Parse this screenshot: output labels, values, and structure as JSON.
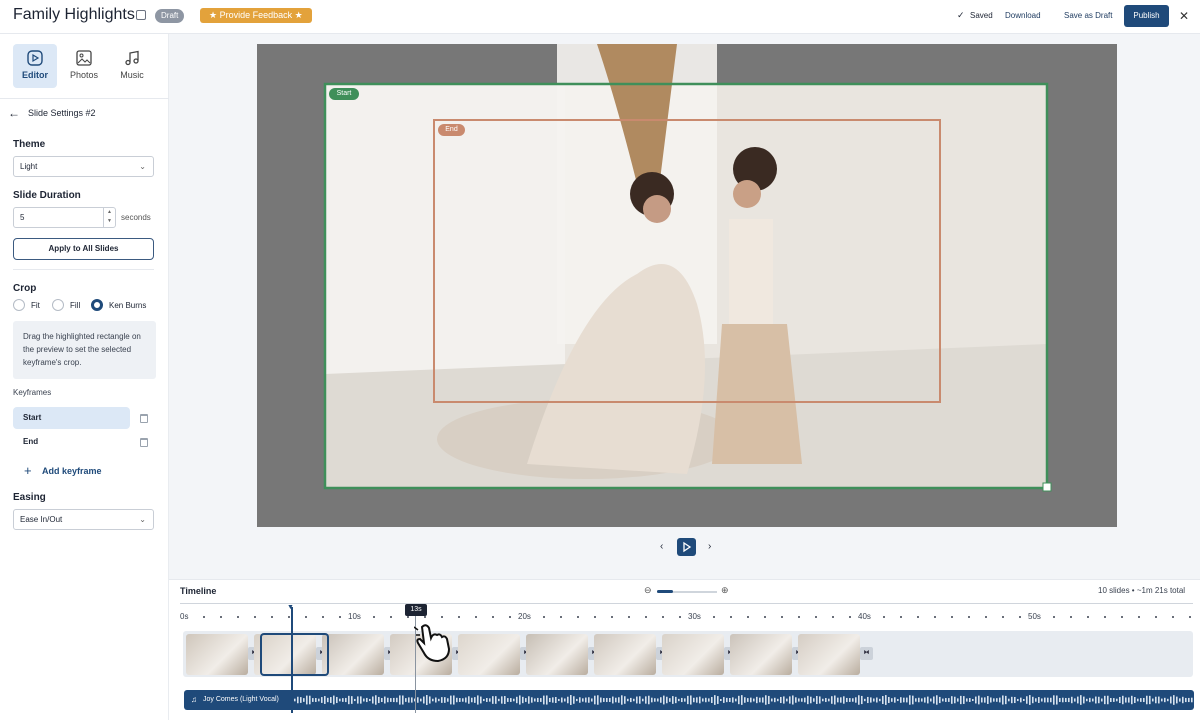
{
  "header": {
    "title": "Family Highlights",
    "draft_badge": "Draft",
    "feedback_label": "★ Provide Feedback ★",
    "saved_label": "Saved",
    "download_label": "Download",
    "save_draft_label": "Save as Draft",
    "publish_label": "Publish"
  },
  "sidebar": {
    "tabs": [
      {
        "label": "Editor",
        "icon": "play-square-icon"
      },
      {
        "label": "Photos",
        "icon": "image-icon"
      },
      {
        "label": "Music",
        "icon": "music-note-icon"
      }
    ],
    "slide_settings_title": "Slide Settings #2",
    "theme_label": "Theme",
    "theme_value": "Light",
    "duration_label": "Slide Duration",
    "duration_value": "5",
    "duration_unit": "seconds",
    "apply_all_label": "Apply to All Slides",
    "crop_label": "Crop",
    "crop_options": [
      "Fit",
      "Fill",
      "Ken Burns"
    ],
    "crop_selected": "Ken Burns",
    "crop_help": "Drag the highlighted rectangle on the preview to set the selected keyframe's crop.",
    "keyframes_label": "Keyframes",
    "keyframes": [
      "Start",
      "End"
    ],
    "add_keyframe_label": "Add keyframe",
    "easing_label": "Easing",
    "easing_value": "Ease In/Out"
  },
  "preview": {
    "start_tag": "Start",
    "end_tag": "End",
    "colors": {
      "start_box": "#3f8f5a",
      "end_box": "#c98a6e"
    }
  },
  "timeline": {
    "title": "Timeline",
    "summary": "10 slides • ~1m 21s total",
    "ticks": [
      "0s",
      "10s",
      "20s",
      "30s",
      "40s",
      "50s"
    ],
    "playhead_label": "13s",
    "audio_track": "Joy Comes (Light Vocal)"
  },
  "colors": {
    "accent": "#1f4a7a",
    "feedback": "#e3a23b"
  }
}
